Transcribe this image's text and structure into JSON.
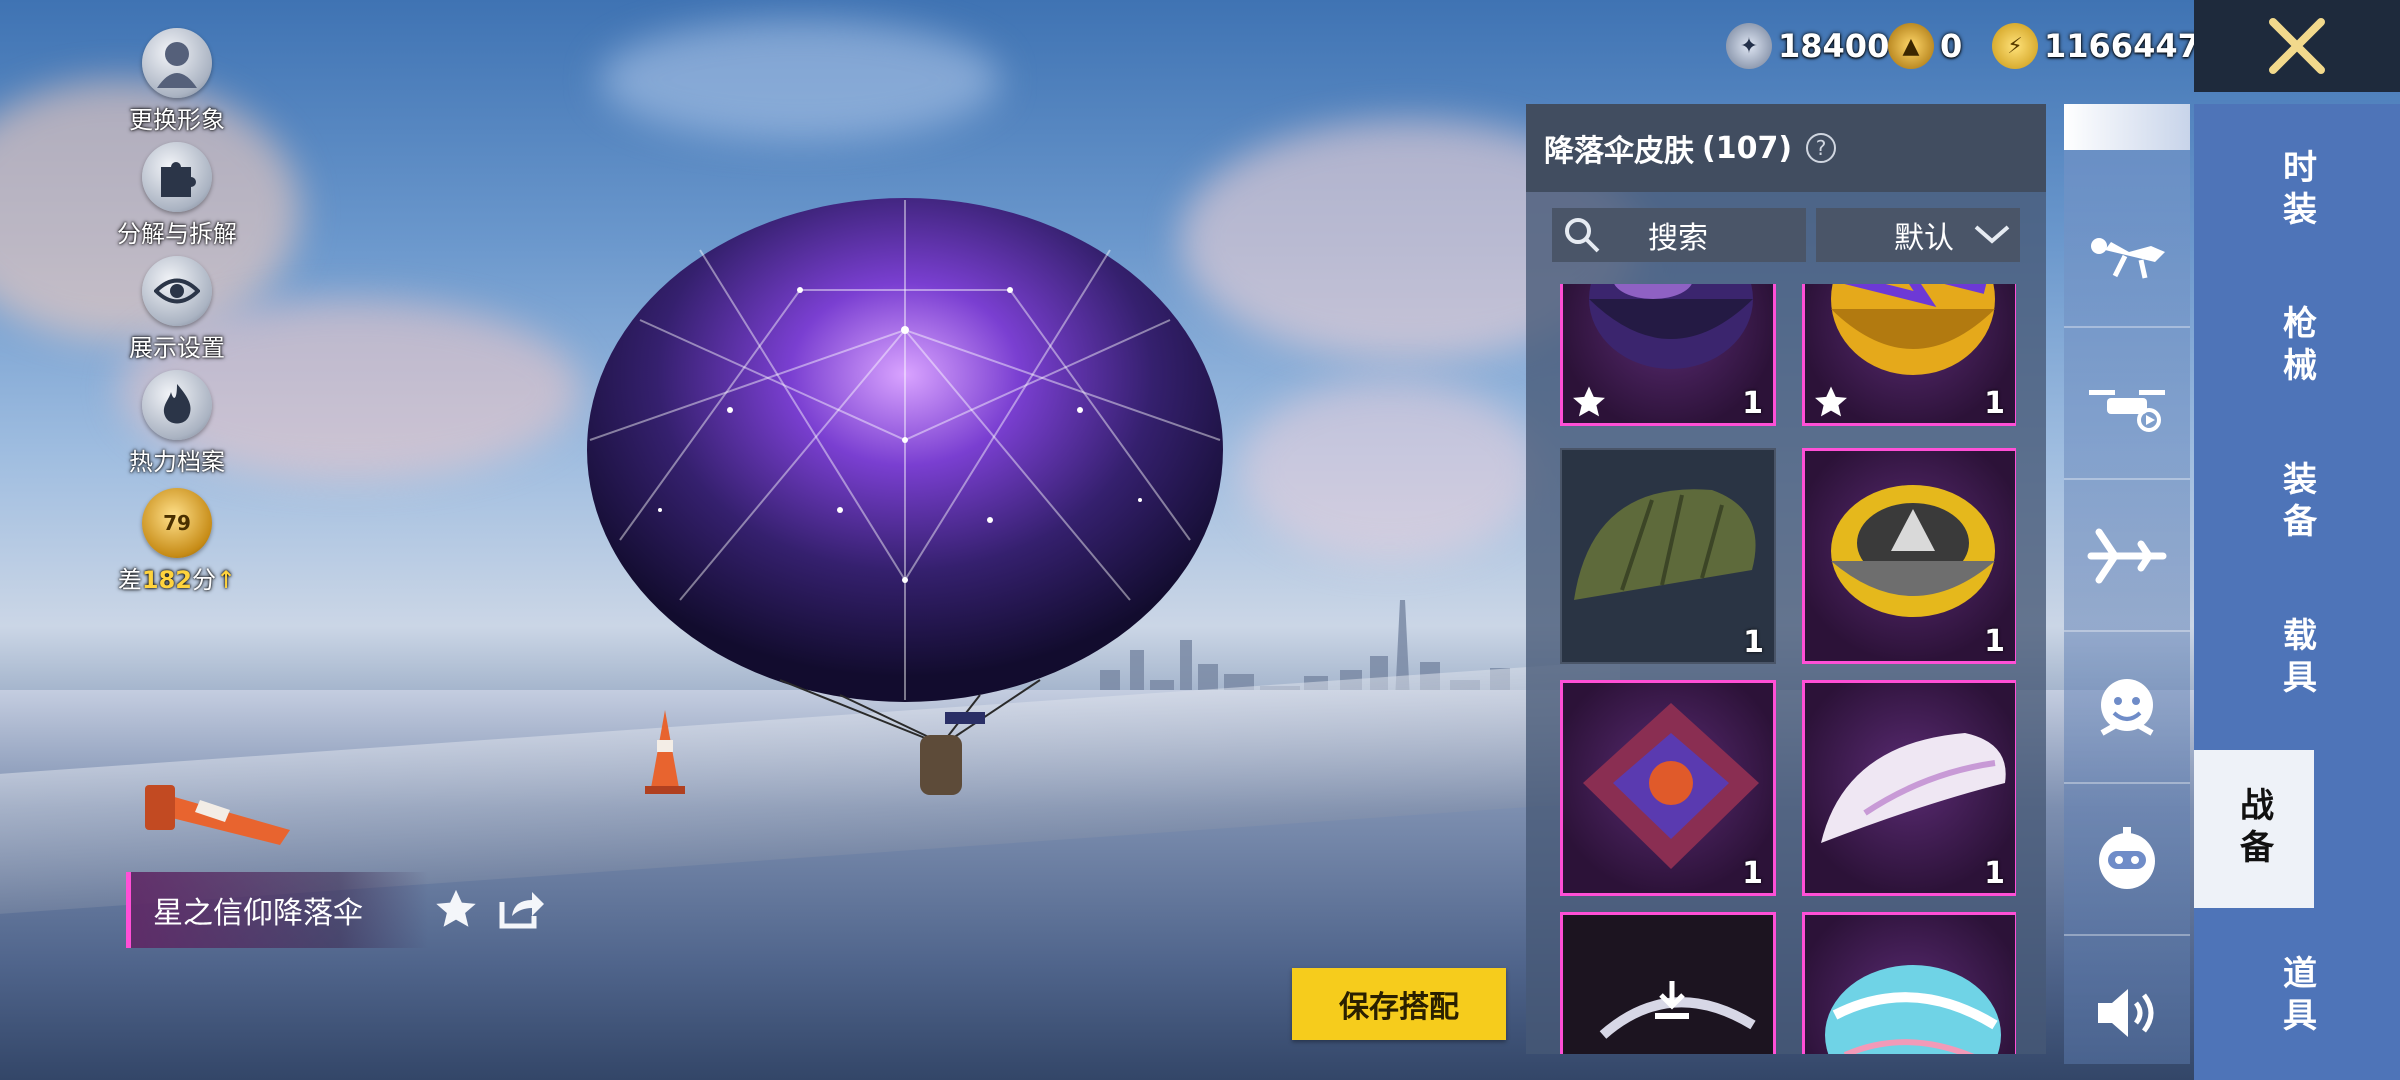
{
  "currencies": [
    {
      "icon": "silver-coin-icon",
      "value": "18400"
    },
    {
      "icon": "gold-emblem-icon",
      "value": "0"
    },
    {
      "icon": "lightning-coin-icon",
      "value": "1166447"
    }
  ],
  "left_actions": [
    {
      "icon": "avatar-icon",
      "label": "更换形象"
    },
    {
      "icon": "puzzle-icon",
      "label": "分解与拆解"
    },
    {
      "icon": "eye-icon",
      "label": "展示设置"
    },
    {
      "icon": "flame-icon",
      "label": "热力档案"
    }
  ],
  "rank": {
    "level": "79",
    "prefix": "差",
    "points": "182",
    "suffix": "分"
  },
  "panel": {
    "title": "降落伞皮肤",
    "count": "(107)",
    "help_icon": "?",
    "search_label": "搜索",
    "sort_label": "默认"
  },
  "items": [
    {
      "style": "galaxy",
      "count": "1",
      "favorite": true,
      "selected": true
    },
    {
      "style": "yellow-lightning",
      "count": "1",
      "favorite": true,
      "selected": true
    },
    {
      "style": "olive",
      "count": "1",
      "favorite": false,
      "selected": false
    },
    {
      "style": "yellow-emblem",
      "count": "1",
      "favorite": false,
      "selected": true
    },
    {
      "style": "diamond-purple",
      "count": "1",
      "favorite": false,
      "selected": true
    },
    {
      "style": "white-silk",
      "count": "1",
      "favorite": false,
      "selected": true
    },
    {
      "style": "download-dark",
      "count": "",
      "favorite": false,
      "selected": true
    },
    {
      "style": "cyan-swirl",
      "count": "",
      "favorite": false,
      "selected": true
    }
  ],
  "category_icons": [
    "skydiver-icon",
    "drone-icon",
    "airplane-icon",
    "emote-face-icon",
    "robot-companion-icon",
    "speaker-icon"
  ],
  "menu": [
    {
      "label": "时装",
      "active": false
    },
    {
      "label": "枪械",
      "active": false
    },
    {
      "label": "装备",
      "active": false
    },
    {
      "label": "载具",
      "active": false
    },
    {
      "label": "战备",
      "active": true
    },
    {
      "label": "道具",
      "active": false
    }
  ],
  "selected_item_name": "星之信仰降落伞",
  "save_button": "保存搭配",
  "colors": {
    "accent_pink": "#ff4fd6",
    "save_yellow": "#f6cc1c",
    "menu_blue": "#4e74b8"
  }
}
